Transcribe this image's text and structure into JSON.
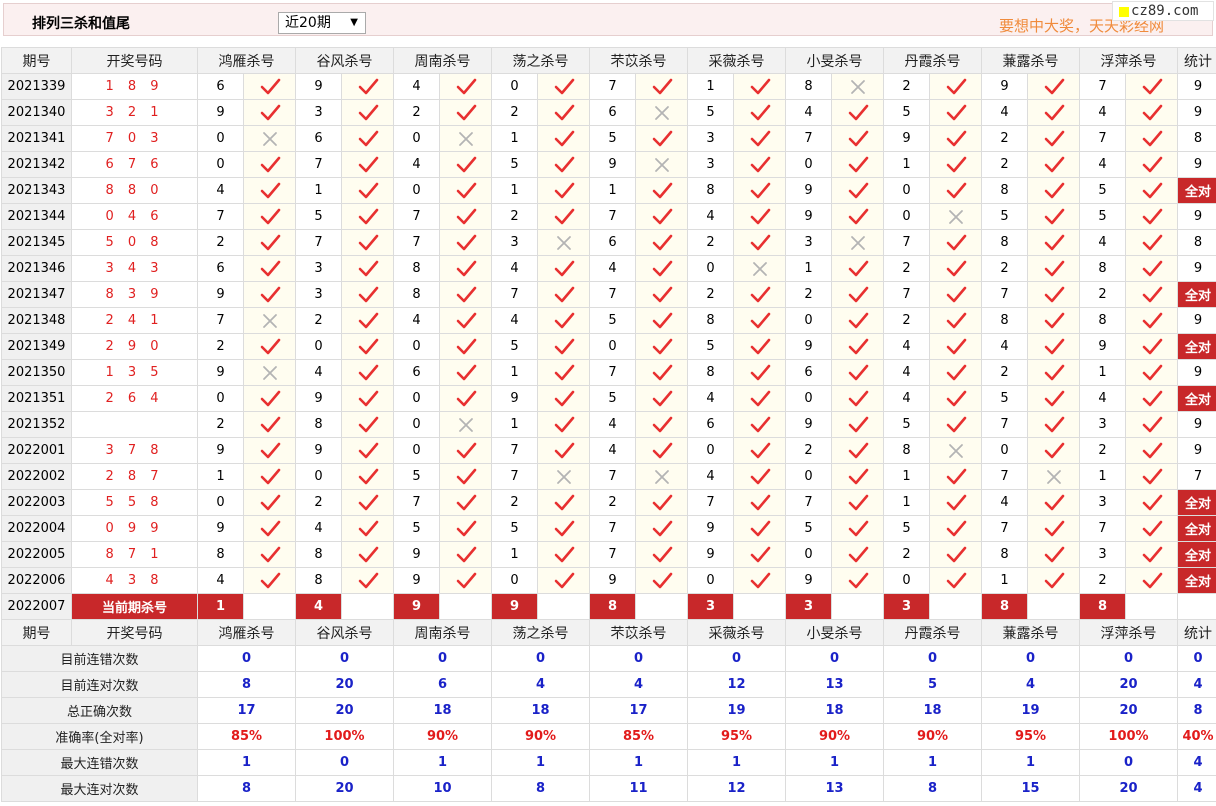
{
  "header": {
    "title": "排列三杀和值尾",
    "period_select": "近20期",
    "slogan": "要想中大奖，天天彩经网",
    "site": "cz89.com"
  },
  "columns": {
    "issue": "期号",
    "draw": "开奖号码",
    "experts": [
      "鸿雁杀号",
      "谷风杀号",
      "周南杀号",
      "荡之杀号",
      "芣苡杀号",
      "采薇杀号",
      "小旻杀号",
      "丹霞杀号",
      "蒹露杀号",
      "浮萍杀号"
    ],
    "stat": "统计"
  },
  "colors": {
    "hit": "#e83030",
    "miss": "#b4b4b4",
    "accent": "#c8282a",
    "blue": "#1a22c8"
  },
  "rows": [
    {
      "issue": "2021339",
      "draw": "1 8 9",
      "kills": [
        6,
        9,
        4,
        0,
        7,
        1,
        8,
        2,
        9,
        7
      ],
      "hits": [
        1,
        1,
        1,
        1,
        1,
        1,
        0,
        1,
        1,
        1
      ],
      "stat": "9"
    },
    {
      "issue": "2021340",
      "draw": "3 2 1",
      "kills": [
        9,
        3,
        2,
        2,
        6,
        5,
        4,
        5,
        4,
        4
      ],
      "hits": [
        1,
        1,
        1,
        1,
        0,
        1,
        1,
        1,
        1,
        1
      ],
      "stat": "9"
    },
    {
      "issue": "2021341",
      "draw": "7 0 3",
      "kills": [
        0,
        6,
        0,
        1,
        5,
        3,
        7,
        9,
        2,
        7
      ],
      "hits": [
        0,
        1,
        0,
        1,
        1,
        1,
        1,
        1,
        1,
        1
      ],
      "stat": "8"
    },
    {
      "issue": "2021342",
      "draw": "6 7 6",
      "kills": [
        0,
        7,
        4,
        5,
        9,
        3,
        0,
        1,
        2,
        4
      ],
      "hits": [
        1,
        1,
        1,
        1,
        0,
        1,
        1,
        1,
        1,
        1
      ],
      "stat": "9"
    },
    {
      "issue": "2021343",
      "draw": "8 8 0",
      "kills": [
        4,
        1,
        0,
        1,
        1,
        8,
        9,
        0,
        8,
        5
      ],
      "hits": [
        1,
        1,
        1,
        1,
        1,
        1,
        1,
        1,
        1,
        1
      ],
      "stat": "全对"
    },
    {
      "issue": "2021344",
      "draw": "0 4 6",
      "kills": [
        7,
        5,
        7,
        2,
        7,
        4,
        9,
        0,
        5,
        5
      ],
      "hits": [
        1,
        1,
        1,
        1,
        1,
        1,
        1,
        0,
        1,
        1
      ],
      "stat": "9"
    },
    {
      "issue": "2021345",
      "draw": "5 0 8",
      "kills": [
        2,
        7,
        7,
        3,
        6,
        2,
        3,
        7,
        8,
        4
      ],
      "hits": [
        1,
        1,
        1,
        0,
        1,
        1,
        0,
        1,
        1,
        1
      ],
      "stat": "8"
    },
    {
      "issue": "2021346",
      "draw": "3 4 3",
      "kills": [
        6,
        3,
        8,
        4,
        4,
        0,
        1,
        2,
        2,
        8
      ],
      "hits": [
        1,
        1,
        1,
        1,
        1,
        0,
        1,
        1,
        1,
        1
      ],
      "stat": "9"
    },
    {
      "issue": "2021347",
      "draw": "8 3 9",
      "kills": [
        9,
        3,
        8,
        7,
        7,
        2,
        2,
        7,
        7,
        2
      ],
      "hits": [
        1,
        1,
        1,
        1,
        1,
        1,
        1,
        1,
        1,
        1
      ],
      "stat": "全对"
    },
    {
      "issue": "2021348",
      "draw": "2 4 1",
      "kills": [
        7,
        2,
        4,
        4,
        5,
        8,
        0,
        2,
        8,
        8
      ],
      "hits": [
        0,
        1,
        1,
        1,
        1,
        1,
        1,
        1,
        1,
        1
      ],
      "stat": "9"
    },
    {
      "issue": "2021349",
      "draw": "2 9 0",
      "kills": [
        2,
        0,
        0,
        5,
        0,
        5,
        9,
        4,
        4,
        9
      ],
      "hits": [
        1,
        1,
        1,
        1,
        1,
        1,
        1,
        1,
        1,
        1
      ],
      "stat": "全对"
    },
    {
      "issue": "2021350",
      "draw": "1 3 5",
      "kills": [
        9,
        4,
        6,
        1,
        7,
        8,
        6,
        4,
        2,
        1
      ],
      "hits": [
        0,
        1,
        1,
        1,
        1,
        1,
        1,
        1,
        1,
        1
      ],
      "stat": "9"
    },
    {
      "issue": "2021351",
      "draw": "2 6 4",
      "kills": [
        0,
        9,
        0,
        9,
        5,
        4,
        0,
        4,
        5,
        4
      ],
      "hits": [
        1,
        1,
        1,
        1,
        1,
        1,
        1,
        1,
        1,
        1
      ],
      "stat": "全对"
    },
    {
      "issue": "2021352",
      "draw": "",
      "kills": [
        2,
        8,
        0,
        1,
        4,
        6,
        9,
        5,
        7,
        3
      ],
      "hits": [
        1,
        1,
        0,
        1,
        1,
        1,
        1,
        1,
        1,
        1
      ],
      "stat": "9"
    },
    {
      "issue": "2022001",
      "draw": "3 7 8",
      "kills": [
        9,
        9,
        0,
        7,
        4,
        0,
        2,
        8,
        0,
        2
      ],
      "hits": [
        1,
        1,
        1,
        1,
        1,
        1,
        1,
        0,
        1,
        1
      ],
      "stat": "9"
    },
    {
      "issue": "2022002",
      "draw": "2 8 7",
      "kills": [
        1,
        0,
        5,
        7,
        7,
        4,
        0,
        1,
        7,
        1
      ],
      "hits": [
        1,
        1,
        1,
        0,
        0,
        1,
        1,
        1,
        0,
        1
      ],
      "stat": "7"
    },
    {
      "issue": "2022003",
      "draw": "5 5 8",
      "kills": [
        0,
        2,
        7,
        2,
        2,
        7,
        7,
        1,
        4,
        3
      ],
      "hits": [
        1,
        1,
        1,
        1,
        1,
        1,
        1,
        1,
        1,
        1
      ],
      "stat": "全对"
    },
    {
      "issue": "2022004",
      "draw": "0 9 9",
      "kills": [
        9,
        4,
        5,
        5,
        7,
        9,
        5,
        5,
        7,
        7
      ],
      "hits": [
        1,
        1,
        1,
        1,
        1,
        1,
        1,
        1,
        1,
        1
      ],
      "stat": "全对"
    },
    {
      "issue": "2022005",
      "draw": "8 7 1",
      "kills": [
        8,
        8,
        9,
        1,
        7,
        9,
        0,
        2,
        8,
        3
      ],
      "hits": [
        1,
        1,
        1,
        1,
        1,
        1,
        1,
        1,
        1,
        1
      ],
      "stat": "全对"
    },
    {
      "issue": "2022006",
      "draw": "4 3 8",
      "kills": [
        4,
        8,
        9,
        0,
        9,
        0,
        9,
        0,
        1,
        2
      ],
      "hits": [
        1,
        1,
        1,
        1,
        1,
        1,
        1,
        1,
        1,
        1
      ],
      "stat": "全对"
    }
  ],
  "current": {
    "issue": "2022007",
    "label": "当前期杀号",
    "kills": [
      "1",
      "4",
      "9",
      "9",
      "8",
      "3",
      "3",
      "3",
      "8",
      "8"
    ]
  },
  "summary": [
    {
      "label": "目前连错次数",
      "values": [
        "0",
        "0",
        "0",
        "0",
        "0",
        "0",
        "0",
        "0",
        "0",
        "0"
      ],
      "stat": "0"
    },
    {
      "label": "目前连对次数",
      "values": [
        "8",
        "20",
        "6",
        "4",
        "4",
        "12",
        "13",
        "5",
        "4",
        "20"
      ],
      "stat": "4"
    },
    {
      "label": "总正确次数",
      "values": [
        "17",
        "20",
        "18",
        "18",
        "17",
        "19",
        "18",
        "18",
        "19",
        "20"
      ],
      "stat": "8"
    },
    {
      "label": "准确率(全对率)",
      "values": [
        "85%",
        "100%",
        "90%",
        "90%",
        "85%",
        "95%",
        "90%",
        "90%",
        "95%",
        "100%"
      ],
      "stat": "40%"
    },
    {
      "label": "最大连错次数",
      "values": [
        "1",
        "0",
        "1",
        "1",
        "1",
        "1",
        "1",
        "1",
        "1",
        "0"
      ],
      "stat": "4"
    },
    {
      "label": "最大连对次数",
      "values": [
        "8",
        "20",
        "10",
        "8",
        "11",
        "12",
        "13",
        "8",
        "15",
        "20"
      ],
      "stat": "4"
    }
  ]
}
